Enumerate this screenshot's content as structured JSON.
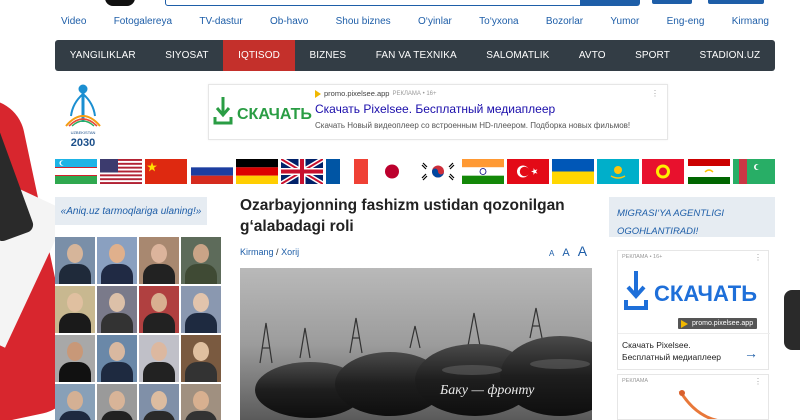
{
  "top_links": [
    "Video",
    "Fotogalereya",
    "TV-dastur",
    "Ob-havo",
    "Shou biznes",
    "O‘yinlar",
    "To‘yxona",
    "Bozorlar",
    "Yumor",
    "Eng-eng",
    "Kirmang"
  ],
  "main_nav": {
    "items": [
      "YANGILIKLAR",
      "SIYOSAT",
      "IQTISOD",
      "BIZNES",
      "FAN VA TEXNIKA",
      "SALOMATLIK",
      "AVTO",
      "SPORT",
      "STADION.UZ"
    ],
    "active": "IQTISOD",
    "active_color": "#c4302b",
    "bar_color": "#333d45"
  },
  "logo": {
    "text": "2030",
    "subtext": "UZBEKISTAN"
  },
  "top_ad": {
    "logo_text": "СКАЧАТЬ",
    "source": "promo.pixelsee.app",
    "tag": "РЕКЛАМА • 16+",
    "headline": "Скачать Pixelsee. Бесплатный медиаплеер",
    "description": "Скачать Новый видеоплеер со встроенным HD-плеером. Подборка новых фильмов!"
  },
  "flags": [
    "uzbekistan",
    "usa",
    "china",
    "russia",
    "germany",
    "uk",
    "france",
    "japan",
    "south-korea",
    "india",
    "turkey",
    "ukraine",
    "kazakhstan",
    "kyrgyzstan",
    "tajikistan",
    "turkmenistan"
  ],
  "left_sidebar": {
    "follow_text": "«Aniq.uz tarmoqlariga ulaning!»",
    "leaders_count": 16
  },
  "article": {
    "title": "Ozarbayjonning fashizm ustidan qozonilgan g‘alabadagi roli",
    "category_1": "Kirmang",
    "separator": "/",
    "category_2": "Xorij",
    "font_small": "A",
    "font_medium": "A",
    "font_large": "A",
    "image_caption_text": "Баку — фронту"
  },
  "right_sidebar": {
    "news_agency": "MIGRASI‘YA AGENTLIGI OGOHLANTIRADI!",
    "ad": {
      "tag": "РЕКЛАМА • 16+",
      "logo_text": "СКАЧАТЬ",
      "source": "promo.pixelsee.app",
      "headline": "Скачать Pixelsee. Бесплатный медиаплеер"
    },
    "ad2": {
      "tag": "РЕКЛАМА"
    }
  }
}
